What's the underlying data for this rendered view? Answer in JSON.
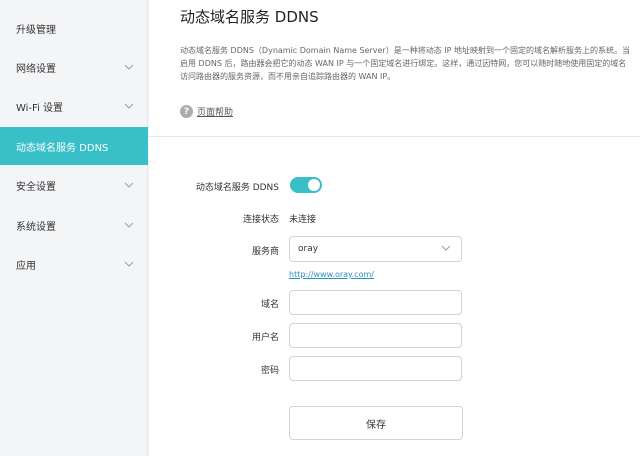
{
  "sidebar": {
    "items": [
      {
        "label": "升级管理",
        "expandable": false,
        "active": false
      },
      {
        "label": "网络设置",
        "expandable": true,
        "active": false
      },
      {
        "label": "Wi-Fi 设置",
        "expandable": true,
        "active": false
      },
      {
        "label": "动态域名服务 DDNS",
        "expandable": false,
        "active": true
      },
      {
        "label": "安全设置",
        "expandable": true,
        "active": false
      },
      {
        "label": "系统设置",
        "expandable": true,
        "active": false
      },
      {
        "label": "应用",
        "expandable": true,
        "active": false
      }
    ]
  },
  "header": {
    "title": "动态域名服务 DDNS",
    "description": "动态域名服务 DDNS（Dynamic Domain Name Server）是一种将动态 IP 地址映射到一个固定的域名解析服务上的系统。当启用 DDNS 后，路由器会把它的动态 WAN IP 与一个固定域名进行绑定。这样，通过因特网，您可以随时随地使用固定的域名访问路由器的服务资源，而不用亲自追踪路由器的 WAN IP。",
    "help_icon": "?",
    "help_label": "页面帮助"
  },
  "form": {
    "ddns_label": "动态域名服务 DDNS",
    "ddns_enabled": true,
    "status_label": "连接状态",
    "status_value": "未连接",
    "provider_label": "服务商",
    "provider_value": "oray",
    "provider_link": "http://www.oray.com/",
    "domain_label": "域名",
    "domain_value": "",
    "username_label": "用户名",
    "username_value": "",
    "password_label": "密码",
    "password_value": "",
    "save_label": "保存"
  },
  "colors": {
    "accent": "#38bfc7",
    "link": "#2f8fc5",
    "sidebar_bg": "#f4f5f7"
  }
}
